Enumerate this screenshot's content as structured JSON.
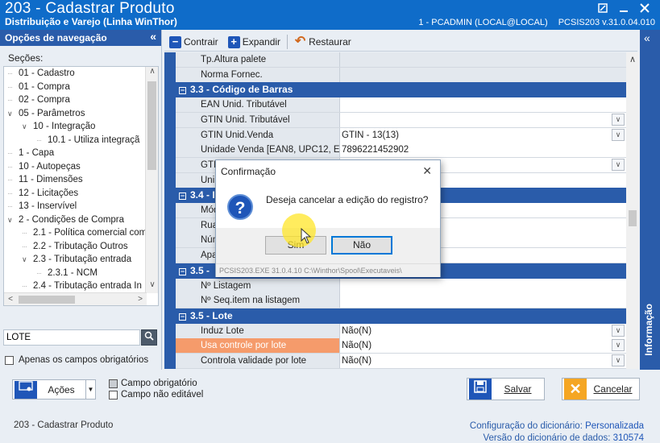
{
  "window": {
    "title": "203 - Cadastrar  Produto",
    "subtitle": "Distribuição e Varejo (Linha WinThor)",
    "user": "1 - PCADMIN (LOCAL@LOCAL)",
    "routine_version": "PCSIS203  v.31.0.04.010"
  },
  "nav": {
    "header": "Opções de navegação",
    "sections_label": "Seções:",
    "items": [
      {
        "label": "01 - Cadastro",
        "indent": 0,
        "toggle": ""
      },
      {
        "label": "01 - Compra",
        "indent": 0,
        "toggle": ""
      },
      {
        "label": "02 - Compra",
        "indent": 0,
        "toggle": ""
      },
      {
        "label": "05 - Parâmetros",
        "indent": 0,
        "toggle": "∨"
      },
      {
        "label": "10 - Integração",
        "indent": 1,
        "toggle": "∨"
      },
      {
        "label": "10.1 - Utiliza integraçã",
        "indent": 2,
        "toggle": ""
      },
      {
        "label": "1 - Capa",
        "indent": 0,
        "toggle": ""
      },
      {
        "label": "10 - Autopeças",
        "indent": 0,
        "toggle": ""
      },
      {
        "label": "11 - Dimensões",
        "indent": 0,
        "toggle": ""
      },
      {
        "label": "12 - Licitações",
        "indent": 0,
        "toggle": ""
      },
      {
        "label": "13 - Inservível",
        "indent": 0,
        "toggle": ""
      },
      {
        "label": "2 - Condições de Compra",
        "indent": 0,
        "toggle": "∨"
      },
      {
        "label": "2.1 - Política comercial com",
        "indent": 1,
        "toggle": ""
      },
      {
        "label": "2.2 - Tributação Outros",
        "indent": 1,
        "toggle": ""
      },
      {
        "label": "2.3 - Tributação entrada",
        "indent": 1,
        "toggle": "∨"
      },
      {
        "label": "2.3.1 - NCM",
        "indent": 2,
        "toggle": ""
      },
      {
        "label": "2.4 - Tributação entrada In",
        "indent": 1,
        "toggle": ""
      },
      {
        "label": "2.2 - Tributação Outros",
        "indent": 0,
        "toggle": ""
      }
    ],
    "filter_value": "LOTE",
    "required_only_label": "Apenas os campos obrigatórios"
  },
  "toolbar": {
    "collapse_label": "Contrair",
    "expand_label": "Expandir",
    "restore_label": "Restaurar"
  },
  "grid": {
    "rows": [
      {
        "type": "field",
        "label": "Tp.Altura palete",
        "value": "",
        "shaded": true,
        "dropdown": false
      },
      {
        "type": "field",
        "label": "Norma Fornec.",
        "value": "",
        "shaded": true,
        "dropdown": false
      },
      {
        "type": "section",
        "label": "3.3 - Código de Barras"
      },
      {
        "type": "field",
        "label": "EAN Unid. Tributável",
        "value": "",
        "shaded": false,
        "dropdown": false
      },
      {
        "type": "field",
        "label": "GTIN Unid. Tributável",
        "value": "",
        "shaded": false,
        "dropdown": true
      },
      {
        "type": "field",
        "label": "GTIN Unid.Venda",
        "value": "GTIN - 13(13)",
        "shaded": false,
        "dropdown": true
      },
      {
        "type": "field",
        "label": "Unidade Venda [EAN8, UPC12, EA",
        "value": "7896221452902",
        "shaded": false,
        "dropdown": false
      },
      {
        "type": "field",
        "label": "GTI",
        "value": "",
        "shaded": false,
        "dropdown": true
      },
      {
        "type": "field",
        "label": "Uni",
        "value": "",
        "shaded": false,
        "dropdown": false
      },
      {
        "type": "section",
        "label": "3.4 - I"
      },
      {
        "type": "field",
        "label": "Mód",
        "value": "",
        "shaded": false,
        "dropdown": false
      },
      {
        "type": "field",
        "label": "Rua",
        "value": "",
        "shaded": false,
        "dropdown": false
      },
      {
        "type": "field",
        "label": "Núm",
        "value": "",
        "shaded": false,
        "dropdown": false
      },
      {
        "type": "field",
        "label": "Apa",
        "value": "",
        "shaded": false,
        "dropdown": false
      },
      {
        "type": "section",
        "label": "3.5 -"
      },
      {
        "type": "field",
        "label": "Nº Listagem",
        "value": "",
        "shaded": false,
        "dropdown": false
      },
      {
        "type": "field",
        "label": "Nº Seq.item na listagem",
        "value": "",
        "shaded": false,
        "dropdown": false
      },
      {
        "type": "section",
        "label": "3.5 - Lote"
      },
      {
        "type": "field",
        "label": "Induz Lote",
        "value": "Não(N)",
        "shaded": false,
        "dropdown": true
      },
      {
        "type": "field",
        "label": "Usa controle por lote",
        "value": "Não(N)",
        "shaded": false,
        "dropdown": true,
        "highlight": true
      },
      {
        "type": "field",
        "label": "Controla validade por lote",
        "value": "Não(N)",
        "shaded": false,
        "dropdown": true
      }
    ]
  },
  "info_panel": {
    "label": "Informação"
  },
  "bottom": {
    "actions_label": "Ações",
    "legend_required": "Campo obrigatório",
    "legend_readonly": "Campo não editável",
    "save_label": "Salvar",
    "cancel_label": "Cancelar",
    "status_left": "203 - Cadastrar  Produto",
    "dict_config_label": "Configuração do dicionário:",
    "dict_config_value": "Personalizada",
    "dict_version_label": "Versão do dicionário de dados:",
    "dict_version_value": "310574"
  },
  "dialog": {
    "title": "Confirmação",
    "message": "Deseja cancelar a edição do registro?",
    "yes_label": "Sim",
    "no_label": "Não",
    "footer": "PCSIS203.EXE 31.0.4.10 C:\\Winthor\\Spool\\Executaveis\\"
  },
  "colors": {
    "title_bar": "#0f6cc9",
    "section_header": "#2a5caa",
    "highlight_row": "#f59b6b",
    "cancel_accent": "#f5a623"
  }
}
